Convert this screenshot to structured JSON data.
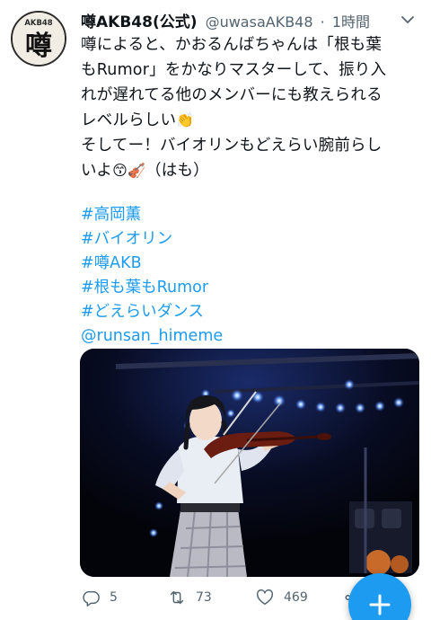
{
  "tweet": {
    "author": {
      "display_name": "噂AKB48(公式)",
      "handle": "@uwasaAKB48",
      "avatar_text": "噂",
      "avatar_sub": "AKB48"
    },
    "separator": "·",
    "time": "1時間",
    "body_lines": [
      "噂によると、かおるんばちゃんは「根も葉",
      "もRumor」をかなりマスターして、振り入",
      "れが遅れてる他のメンバーにも教えられる",
      "レベルらしい",
      "そしてー！バイオリンもどえらい腕前らし",
      "いよ",
      "（はも）"
    ],
    "emojis": {
      "clap": "👏",
      "kiss": "😙",
      "violin": "🎻"
    },
    "tags": [
      "#高岡薫",
      "#バイオリン",
      "#噂AKB",
      "#根も葉もRumor",
      "#どえらいダンス",
      "@runsan_himeme"
    ],
    "actions": {
      "replies": "5",
      "retweets": "73",
      "likes": "469"
    }
  },
  "icons": {
    "more": "chevron-down-icon",
    "reply": "reply-icon",
    "retweet": "retweet-icon",
    "like": "heart-icon",
    "share": "share-icon",
    "compose": "plus-icon"
  },
  "colors": {
    "accent": "#1d9bf0",
    "text": "#0f1419",
    "muted": "#536471"
  }
}
